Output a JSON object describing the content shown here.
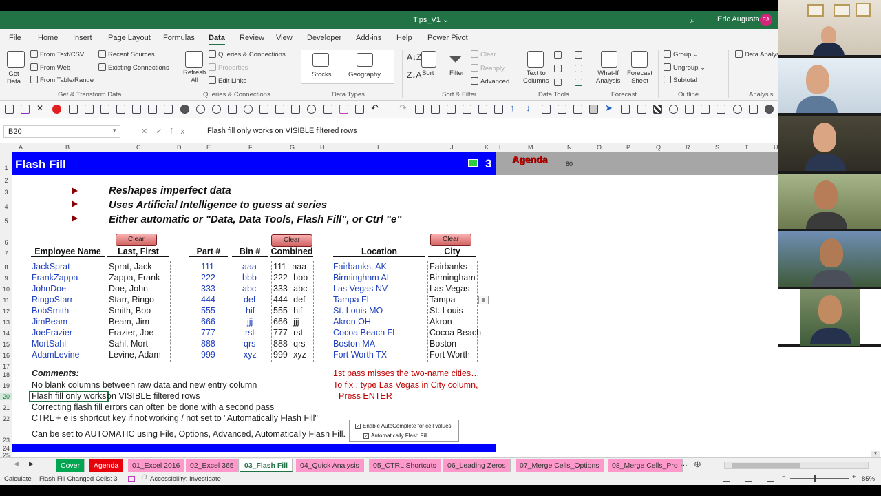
{
  "window": {
    "title": "Tips_V1 ⌄",
    "user": "Eric Augusta",
    "initials": "EA"
  },
  "ribbon_tabs": [
    "File",
    "Home",
    "Insert",
    "Page Layout",
    "Formulas",
    "Data",
    "Review",
    "View",
    "Developer",
    "Add-ins",
    "Help",
    "Power Pivot"
  ],
  "ribbon": {
    "get_data": "Get\nData",
    "from_text": "From Text/CSV",
    "from_web": "From Web",
    "from_table": "From Table/Range",
    "recent_sources": "Recent Sources",
    "existing_connections": "Existing Connections",
    "get_transform": "Get & Transform Data",
    "refresh_all": "Refresh\nAll",
    "queries_connections": "Queries & Connections",
    "properties": "Properties",
    "edit_links": "Edit Links",
    "queries_group": "Queries & Connections",
    "stocks": "Stocks",
    "geography": "Geography",
    "data_types": "Data Types",
    "sort": "Sort",
    "filter": "Filter",
    "clear": "Clear",
    "reapply": "Reapply",
    "advanced": "Advanced",
    "sort_filter": "Sort & Filter",
    "text_to_columns": "Text to\nColumns",
    "data_tools": "Data Tools",
    "what_if": "What-If\nAnalysis",
    "forecast_sheet": "Forecast\nSheet",
    "forecast": "Forecast",
    "group": "Group",
    "ungroup": "Ungroup",
    "subtotal": "Subtotal",
    "outline": "Outline",
    "data_analysis": "Data Analys",
    "analysis": "Analysis"
  },
  "name_box": "B20",
  "formula": "Flash fill only works on VISIBLE filtered rows",
  "columns": [
    "A",
    "B",
    "C",
    "D",
    "E",
    "F",
    "G",
    "H",
    "I",
    "J",
    "K",
    "L",
    "M",
    "N",
    "O",
    "P",
    "Q",
    "R",
    "S",
    "T",
    "U"
  ],
  "rows": [
    "1",
    "2",
    "3",
    "4",
    "5",
    "6",
    "7",
    "8",
    "9",
    "10",
    "11",
    "12",
    "13",
    "14",
    "15",
    "16",
    "17",
    "18",
    "19",
    "20",
    "21",
    "22",
    "23",
    "24",
    "25"
  ],
  "sheet": {
    "title": "Flash Fill",
    "number": "3",
    "agenda": "Agenda",
    "n80": "80",
    "bullets": [
      "Reshapes imperfect data",
      "Uses Artificial Intelligence to guess at series",
      "Either automatic or \"Data, Data Tools, Flash Fill\", or Ctrl \"e\""
    ],
    "clear_label": "Clear",
    "headers": {
      "employee": "Employee Name",
      "last_first": "Last, First",
      "part": "Part #",
      "bin": "Bin #",
      "combined": "Combined",
      "location": "Location",
      "city": "City"
    },
    "employees": [
      "JackSprat",
      "FrankZappa",
      "JohnDoe",
      "RingoStarr",
      "BobSmith",
      "JimBeam",
      "JoeFrazier",
      "MortSahl",
      "AdamLevine"
    ],
    "last_first": [
      "Sprat, Jack",
      "Zappa, Frank",
      "Doe, John",
      "Starr, Ringo",
      "Smith, Bob",
      "Beam, Jim",
      "Frazier, Joe",
      "Sahl, Mort",
      "Levine, Adam"
    ],
    "parts": [
      "111",
      "222",
      "333",
      "444",
      "555",
      "666",
      "777",
      "888",
      "999"
    ],
    "bins": [
      "aaa",
      "bbb",
      "abc",
      "def",
      "hif",
      "jjj",
      "rst",
      "qrs",
      "xyz"
    ],
    "combined": [
      "111--aaa",
      "222--bbb",
      "333--abc",
      "444--def",
      "555--hif",
      "666--jjj",
      "777--rst",
      "888--qrs",
      "999--xyz"
    ],
    "locations": [
      "Fairbanks, AK",
      "Birmingham AL",
      "Las Vegas NV",
      "Tampa FL",
      "St. Louis MO",
      "Akron OH",
      "Cocoa Beach FL",
      "Boston MA",
      "Fort Worth TX"
    ],
    "cities": [
      "Fairbanks",
      "Birmingham",
      "Las Vegas",
      "Tampa",
      "St. Louis",
      "Akron",
      "Cocoa Beach",
      "Boston",
      "Fort Worth"
    ],
    "comments_label": "Comments:",
    "comments": [
      "No blank columns between raw data and new entry column",
      "Flash fill only works",
      "on VISIBLE filtered rows",
      "Correcting flash fill errors can often be done with a second pass",
      "CTRL + e is shortcut key if not working / not set to \"Automatically Flash Fill\"",
      "Can be set to AUTOMATIC using File, Options, Advanced, Automatically Flash Fill."
    ],
    "red_notes": [
      "1st pass misses the two-name cities…",
      "To fix , type Las Vegas in City column,",
      "Press ENTER"
    ],
    "autocomplete": "Enable AutoComplete for cell values",
    "auto_flash": "Automatically Flash Fill"
  },
  "sheet_tabs": [
    {
      "label": "Cover",
      "color": "#00a651",
      "text": "#ffffff"
    },
    {
      "label": "Agenda",
      "color": "#e8000b",
      "text": "#ffffff"
    },
    {
      "label": "01_Excel 2016",
      "color": "#ff99cc",
      "text": "#333333"
    },
    {
      "label": "02_Excel 365",
      "color": "#ff99cc",
      "text": "#333333"
    },
    {
      "label": "03_Flash Fill",
      "color": "#ffffff",
      "text": "#217346"
    },
    {
      "label": "04_Quick Analysis",
      "color": "#ff99cc",
      "text": "#333333"
    },
    {
      "label": "05_CTRL Shortcuts",
      "color": "#ff99cc",
      "text": "#333333"
    },
    {
      "label": "06_Leading Zeros",
      "color": "#ff99cc",
      "text": "#333333"
    },
    {
      "label": "07_Merge Cells_Options",
      "color": "#ff99cc",
      "text": "#333333"
    },
    {
      "label": "08_Merge Cells_Pro",
      "color": "#ff99cc",
      "text": "#333333"
    }
  ],
  "status": {
    "mode": "Calculate",
    "flash": "Flash Fill Changed Cells: 3",
    "accessibility": "Accessibility: Investigate",
    "zoom": "85%"
  }
}
